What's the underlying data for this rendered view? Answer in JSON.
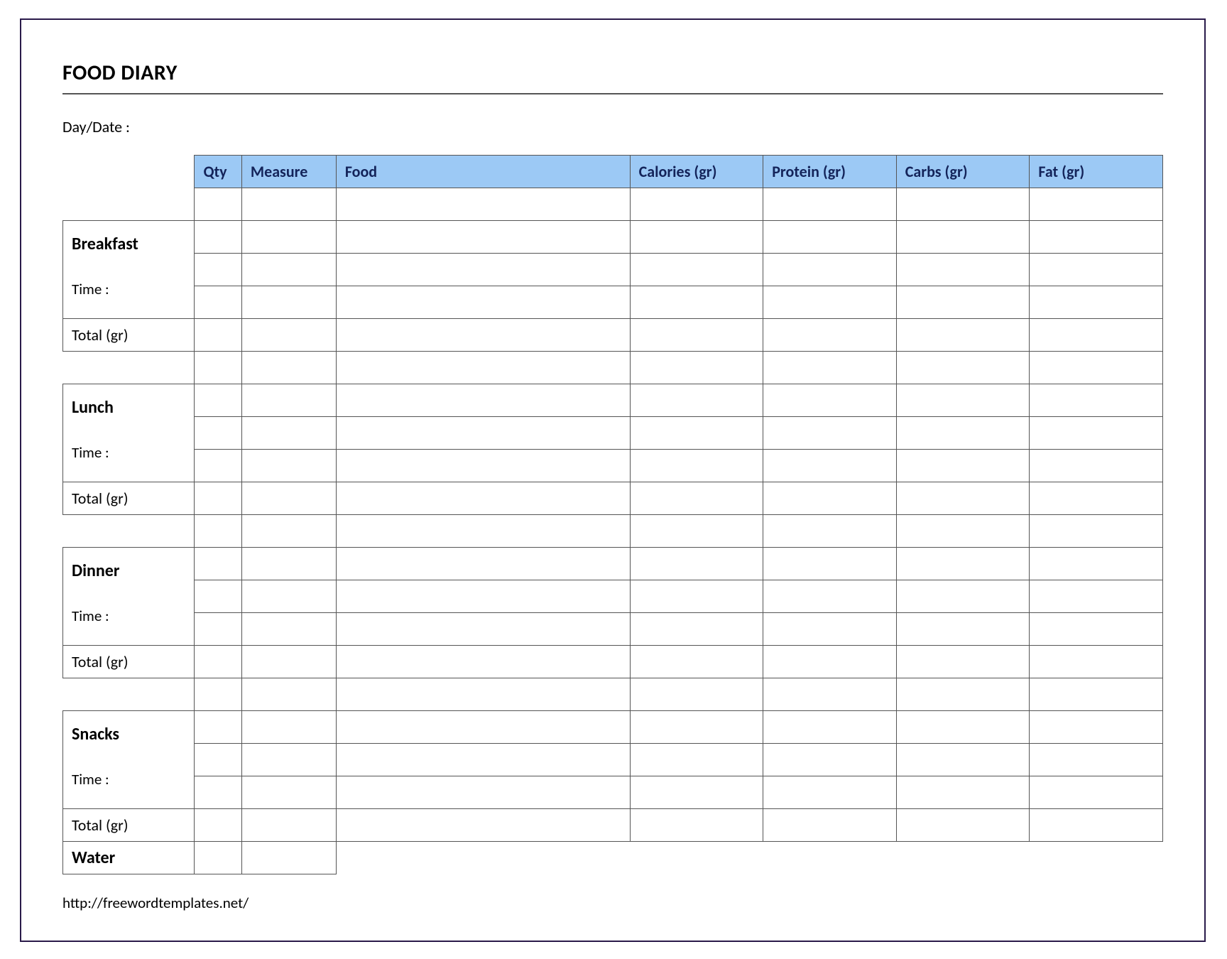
{
  "title": "FOOD DIARY",
  "daydate_label": "Day/Date :",
  "headers": {
    "qty": "Qty",
    "measure": "Measure",
    "food": "Food",
    "calories": "Calories (gr)",
    "protein": "Protein (gr)",
    "carbs": "Carbs (gr)",
    "fat": "Fat (gr)"
  },
  "meals": [
    {
      "name": "Breakfast",
      "time_label": "Time :",
      "total_label": "Total (gr)"
    },
    {
      "name": "Lunch",
      "time_label": "Time :",
      "total_label": "Total (gr)"
    },
    {
      "name": "Dinner",
      "time_label": "Time :",
      "total_label": "Total (gr)"
    },
    {
      "name": "Snacks",
      "time_label": "Time :",
      "total_label": "Total (gr)"
    }
  ],
  "water_label": "Water",
  "footer_url": "http://freewordtemplates.net/"
}
